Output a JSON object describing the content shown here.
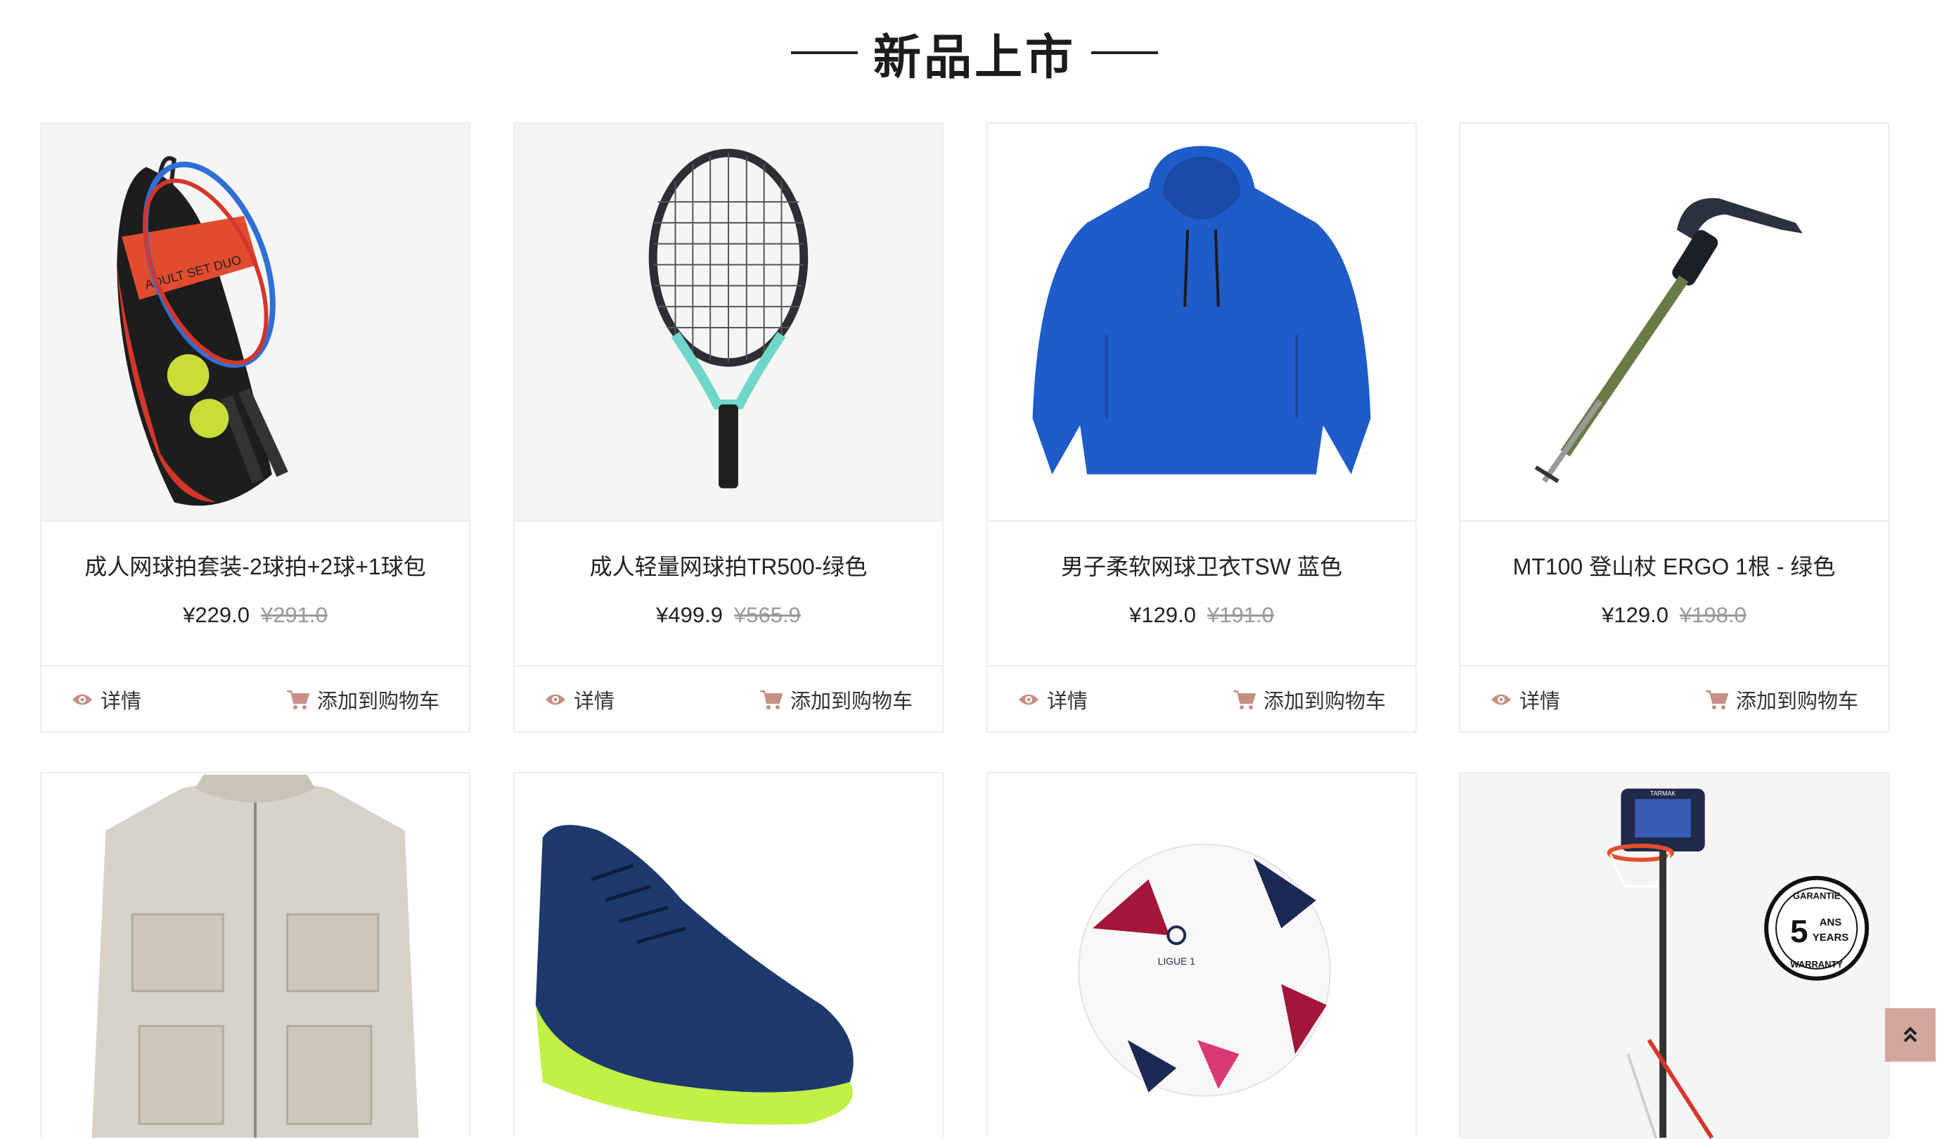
{
  "section": {
    "title": "新品上市"
  },
  "actions": {
    "details_label": "详情",
    "cart_label": "添加到购物车"
  },
  "products": [
    {
      "name": "成人网球拍套装-2球拍+2球+1球包",
      "price": "¥229.0",
      "old_price": "¥291.0",
      "image": "tennis-racket-set-bag"
    },
    {
      "name": "成人轻量网球拍TR500-绿色",
      "price": "¥499.9",
      "old_price": "¥565.9",
      "image": "tennis-racket"
    },
    {
      "name": "男子柔软网球卫衣TSW 蓝色",
      "price": "¥129.0",
      "old_price": "¥191.0",
      "image": "blue-hoodie"
    },
    {
      "name": "MT100 登山杖 ERGO 1根 - 绿色",
      "price": "¥129.0",
      "old_price": "¥198.0",
      "image": "hiking-pole"
    },
    {
      "image": "beige-vest"
    },
    {
      "image": "blue-football-boot"
    },
    {
      "image": "football-ball",
      "ball_label": "LIGUE 1"
    },
    {
      "image": "basketball-hoop",
      "brand_label": "TARMAK",
      "badge": {
        "top": "GARANTIE",
        "number": "5",
        "unit1": "ANS",
        "unit2": "YEARS",
        "bottom": "WARRANTY"
      }
    }
  ],
  "colors": {
    "accent": "#d3a79e",
    "icon": "#c48f85",
    "border": "#eeeeee"
  }
}
